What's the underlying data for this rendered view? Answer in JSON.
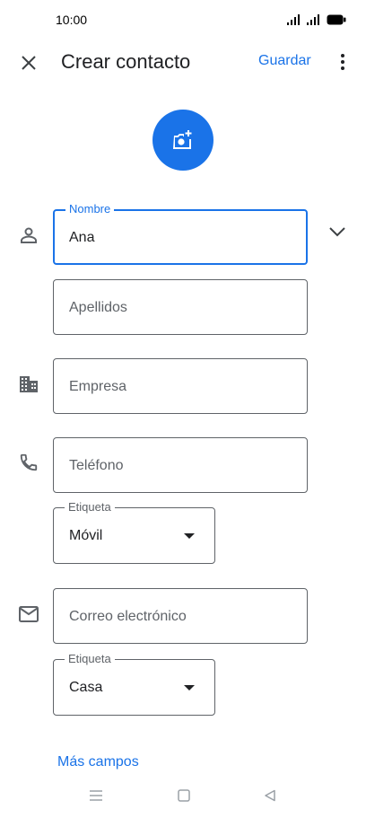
{
  "status_bar": {
    "time": "10:00"
  },
  "app_bar": {
    "title": "Crear contacto",
    "save_label": "Guardar"
  },
  "form": {
    "first_name": {
      "label": "Nombre",
      "value": "Ana"
    },
    "last_name": {
      "placeholder": "Apellidos"
    },
    "company": {
      "placeholder": "Empresa"
    },
    "phone": {
      "placeholder": "Teléfono"
    },
    "phone_label": {
      "label": "Etiqueta",
      "value": "Móvil"
    },
    "email": {
      "placeholder": "Correo electrónico"
    },
    "email_label": {
      "label": "Etiqueta",
      "value": "Casa"
    }
  },
  "more_fields_label": "Más campos",
  "colors": {
    "accent": "#1a73e8",
    "text": "#202124",
    "secondary": "#5f6368"
  },
  "icons": [
    "close-icon",
    "more-vert-icon",
    "add-photo-icon",
    "person-icon",
    "chevron-down-icon",
    "business-icon",
    "phone-icon",
    "email-icon",
    "nav-menu-icon",
    "nav-home-icon",
    "nav-back-icon"
  ]
}
